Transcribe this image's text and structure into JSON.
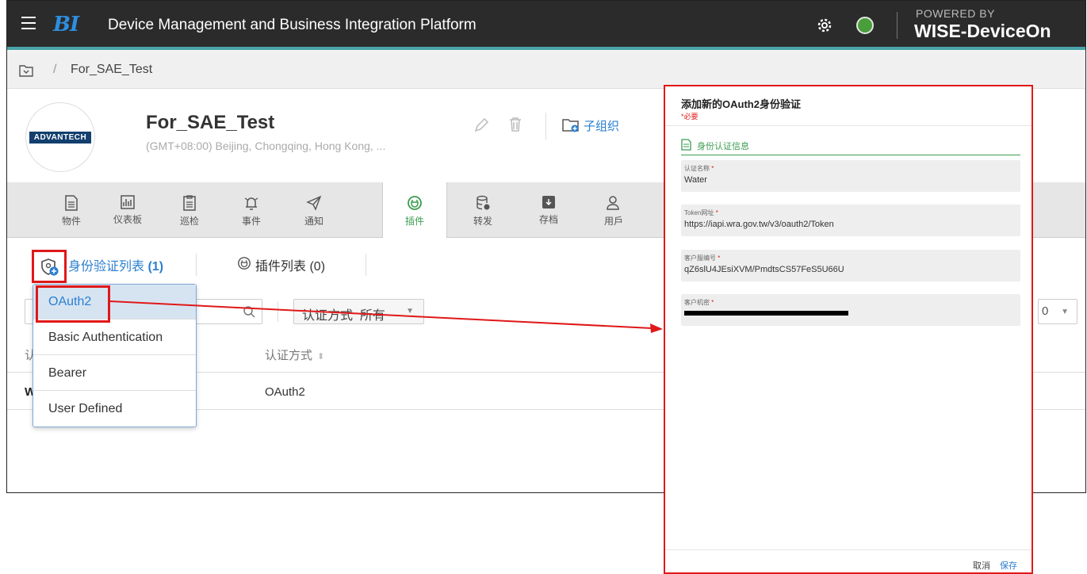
{
  "app": {
    "logo": "BI",
    "title": "Device Management and Business Integration Platform",
    "powered_by": "POWERED BY",
    "brand": "WISE-DeviceOn"
  },
  "breadcrumb": {
    "separator": "/",
    "current": "For_SAE_Test"
  },
  "org": {
    "avatar_text": "ADVANTECH",
    "name": "For_SAE_Test",
    "timezone": "(GMT+08:00) Beijing, Chongqing, Hong Kong, ...",
    "sub_org_label": "子组织"
  },
  "module_tabs": [
    {
      "label": "物件",
      "icon": "document-icon"
    },
    {
      "label": "仪表板",
      "icon": "dashboard-icon"
    },
    {
      "label": "巡检",
      "icon": "clipboard-icon"
    },
    {
      "label": "事件",
      "icon": "alarm-icon"
    },
    {
      "label": "通知",
      "icon": "send-icon"
    },
    {
      "label": "插件",
      "icon": "plugin-icon",
      "active": true
    },
    {
      "label": "转发",
      "icon": "database-icon"
    },
    {
      "label": "存档",
      "icon": "archive-icon"
    },
    {
      "label": "用戶",
      "icon": "user-icon"
    }
  ],
  "subtabs": {
    "auth_list": "身份验证列表",
    "auth_count": "(1)",
    "plugin_list": "插件列表",
    "plugin_count": "(0)"
  },
  "filter": {
    "label": "认证方式",
    "value": "所有"
  },
  "page_size": {
    "value": "0"
  },
  "table": {
    "headers": {
      "name": "认",
      "method": "认证方式"
    },
    "rows": [
      {
        "name": "W",
        "method": "OAuth2"
      }
    ]
  },
  "dropdown": {
    "options": [
      "OAuth2",
      "Basic Authentication",
      "Bearer",
      "User Defined"
    ],
    "selected": "OAuth2"
  },
  "dialog": {
    "title": "添加新的OAuth2身份验证",
    "required_note": "*必要",
    "section": "身份认证信息",
    "fields": [
      {
        "label": "认证名称",
        "value": "Water"
      },
      {
        "label": "Token网址",
        "value": "https://iapi.wra.gov.tw/v3/oauth2/Token"
      },
      {
        "label": "客户服编号",
        "value": "qZ6slU4JEsiXVM/PmdtsCS57FeS5U66U"
      },
      {
        "label": "客户机密",
        "value": ""
      }
    ],
    "required_mark": "*",
    "cancel": "取消",
    "save": "保存"
  },
  "colors": {
    "topbar": "#2b2b2b",
    "accent_blue": "#2b7fd0",
    "accent_green": "#3a9c4f",
    "highlight_red": "#e01818"
  }
}
